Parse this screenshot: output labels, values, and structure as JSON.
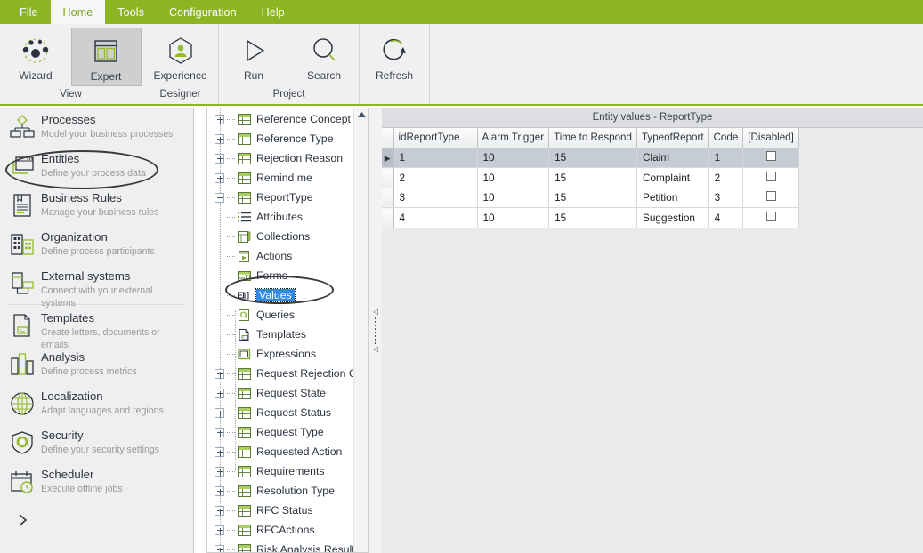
{
  "menubar": {
    "items": [
      {
        "label": "File",
        "active": false
      },
      {
        "label": "Home",
        "active": true
      },
      {
        "label": "Tools",
        "active": false
      },
      {
        "label": "Configuration",
        "active": false
      },
      {
        "label": "Help",
        "active": false
      }
    ],
    "bg_color": "#8cb524",
    "active_text_color": "#7ba520"
  },
  "ribbon": {
    "groups": [
      {
        "label": "View",
        "buttons": [
          {
            "caption": "Wizard",
            "icon": "wizard-nodes-icon",
            "selected": false
          },
          {
            "caption": "Expert",
            "icon": "expert-layout-icon",
            "selected": true
          }
        ]
      },
      {
        "label": "Designer",
        "buttons": [
          {
            "caption": "Experience",
            "icon": "experience-person-hex-icon",
            "selected": false
          }
        ]
      },
      {
        "label": "Project",
        "buttons": [
          {
            "caption": "Run",
            "icon": "play-triangle-icon",
            "selected": false
          },
          {
            "caption": "Search",
            "icon": "magnifier-icon",
            "selected": false
          }
        ]
      },
      {
        "label": "",
        "buttons": [
          {
            "caption": "Refresh",
            "icon": "refresh-circular-arrow-icon",
            "selected": false
          }
        ]
      }
    ]
  },
  "sidebar": {
    "items": [
      {
        "title": "Processes",
        "subtitle": "Model your business processes",
        "icon": "processes-hierarchy-icon",
        "highlighted": false
      },
      {
        "title": "Entities",
        "subtitle": "Define your process data",
        "icon": "entities-window-icon",
        "highlighted": true
      },
      {
        "title": "Business Rules",
        "subtitle": "Manage your business rules",
        "icon": "business-rules-document-icon",
        "highlighted": false
      },
      {
        "title": "Organization",
        "subtitle": "Define process participants",
        "icon": "organization-buildings-icon",
        "highlighted": false
      },
      {
        "title": "External systems",
        "subtitle": "Connect with your external systems",
        "icon": "external-systems-icon",
        "highlighted": false
      },
      {
        "title": "Templates",
        "subtitle": "Create letters, documents  or emails",
        "icon": "templates-page-icon",
        "highlighted": false
      },
      {
        "title": "Analysis",
        "subtitle": "Define process metrics",
        "icon": "analysis-bars-icon",
        "highlighted": false
      },
      {
        "title": "Localization",
        "subtitle": "Adapt languages and regions",
        "icon": "localization-globe-icon",
        "highlighted": false
      },
      {
        "title": "Security",
        "subtitle": "Define your security settings",
        "icon": "security-shield-gear-icon",
        "highlighted": false
      },
      {
        "title": "Scheduler",
        "subtitle": "Execute offline jobs",
        "icon": "scheduler-calendar-clock-icon",
        "highlighted": false
      }
    ],
    "expand_chevron": "chevron-right-icon"
  },
  "tree": {
    "nodes": [
      {
        "label": "Reference Concept",
        "level": 0,
        "expander": "plus",
        "icon": "entity-table-icon",
        "selected": false
      },
      {
        "label": "Reference Type",
        "level": 0,
        "expander": "plus",
        "icon": "entity-table-icon",
        "selected": false
      },
      {
        "label": "Rejection Reason",
        "level": 0,
        "expander": "plus",
        "icon": "entity-table-icon",
        "selected": false
      },
      {
        "label": "Remind me",
        "level": 0,
        "expander": "plus",
        "icon": "entity-table-icon",
        "selected": false
      },
      {
        "label": "ReportType",
        "level": 0,
        "expander": "minus",
        "icon": "entity-table-icon",
        "selected": false
      },
      {
        "label": "Attributes",
        "level": 1,
        "expander": "none",
        "icon": "attributes-list-icon",
        "selected": false
      },
      {
        "label": "Collections",
        "level": 1,
        "expander": "none",
        "icon": "collections-icon",
        "selected": false
      },
      {
        "label": "Actions",
        "level": 1,
        "expander": "none",
        "icon": "actions-play-icon",
        "selected": false
      },
      {
        "label": "Forms",
        "level": 1,
        "expander": "none",
        "icon": "forms-icon",
        "selected": false
      },
      {
        "label": "Values",
        "level": 1,
        "expander": "none",
        "icon": "values-icon",
        "selected": true
      },
      {
        "label": "Queries",
        "level": 1,
        "expander": "none",
        "icon": "queries-search-icon",
        "selected": false
      },
      {
        "label": "Templates",
        "level": 1,
        "expander": "none",
        "icon": "templates-icon",
        "selected": false
      },
      {
        "label": "Expressions",
        "level": 1,
        "expander": "none",
        "icon": "expressions-icon",
        "selected": false
      },
      {
        "label": "Request Rejection Caus",
        "level": 0,
        "expander": "plus",
        "icon": "entity-table-icon",
        "selected": false
      },
      {
        "label": "Request State",
        "level": 0,
        "expander": "plus",
        "icon": "entity-table-icon",
        "selected": false
      },
      {
        "label": "Request Status",
        "level": 0,
        "expander": "plus",
        "icon": "entity-table-icon",
        "selected": false
      },
      {
        "label": "Request Type",
        "level": 0,
        "expander": "plus",
        "icon": "entity-table-icon",
        "selected": false
      },
      {
        "label": "Requested Action",
        "level": 0,
        "expander": "plus",
        "icon": "entity-table-icon",
        "selected": false
      },
      {
        "label": "Requirements",
        "level": 0,
        "expander": "plus",
        "icon": "entity-table-icon",
        "selected": false
      },
      {
        "label": "Resolution Type",
        "level": 0,
        "expander": "plus",
        "icon": "entity-table-icon",
        "selected": false
      },
      {
        "label": "RFC Status",
        "level": 0,
        "expander": "plus",
        "icon": "entity-table-icon",
        "selected": false
      },
      {
        "label": "RFCActions",
        "level": 0,
        "expander": "plus",
        "icon": "entity-table-icon",
        "selected": false
      },
      {
        "label": "Risk Analysis Result",
        "level": 0,
        "expander": "plus",
        "icon": "entity-table-icon",
        "selected": false
      }
    ],
    "scroll_up_icon": "scroll-up-arrow-icon"
  },
  "content": {
    "title": "Entity values - ReportType",
    "grid": {
      "columns": [
        "idReportType",
        "Alarm Trigger",
        "Time to Respond",
        "TypeofReport",
        "Code",
        "[Disabled]"
      ],
      "rows": [
        {
          "selected": true,
          "cells": [
            "1",
            "10",
            "15",
            "Claim",
            "1",
            ""
          ]
        },
        {
          "selected": false,
          "cells": [
            "2",
            "10",
            "15",
            "Complaint",
            "2",
            ""
          ]
        },
        {
          "selected": false,
          "cells": [
            "3",
            "10",
            "15",
            "Petition",
            "3",
            ""
          ]
        },
        {
          "selected": false,
          "cells": [
            "4",
            "10",
            "15",
            "Suggestion",
            "4",
            ""
          ]
        }
      ],
      "disabled_checked": [
        false,
        false,
        false,
        false
      ],
      "row_marker": "current-row-arrow-icon"
    }
  },
  "splitter": {
    "grip": "splitter-grip-icon"
  },
  "colors": {
    "brand_green": "#8cb524",
    "accent_green": "#93bb2c",
    "dark_blue": "#2b3440",
    "selection_blue": "#2f8ae0",
    "row_selection": "#c6ccd4"
  }
}
